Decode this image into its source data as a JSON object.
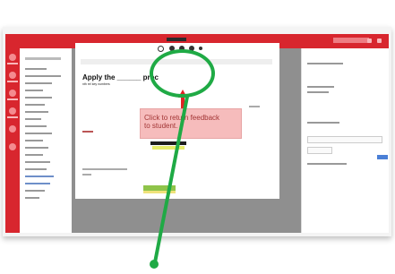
{
  "window": {
    "title": ""
  },
  "topbar": {
    "brand_text": "",
    "accent_color": "#d8262e"
  },
  "modal": {
    "header": "",
    "question": "Apply the ______ proc",
    "question_line2": "nth rel key numbers",
    "callout": {
      "line1": "Click to return feedback",
      "line2": "to student."
    }
  },
  "annotation": {
    "circle_color": "#1faa45",
    "arrow_color": "#e02424"
  }
}
